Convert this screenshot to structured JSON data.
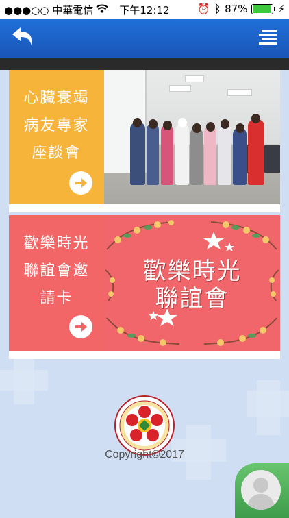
{
  "status_bar": {
    "carrier": "●●●○○ 中華電信",
    "time": "下午12:12",
    "battery": "87%",
    "battery_level": 0.87
  },
  "nav": {
    "back_icon": "undo-arrow-icon",
    "menu_icon": "hamburger-menu-icon"
  },
  "cards": [
    {
      "label": "心臟衰竭\n病友專家\n座談會",
      "color": "#f6b43a",
      "arrow_icon": "arrow-right-circle-icon"
    },
    {
      "label": "歡樂時光\n聯誼會邀\n請卡",
      "color": "#f26668",
      "arrow_icon": "arrow-right-circle-icon",
      "image_title": "歡樂時光\n聯誼會"
    }
  ],
  "footer": {
    "copyright": "Copyright©2017",
    "logo_icon": "nursing-college-logo-icon",
    "avatar_icon": "user-avatar-icon"
  }
}
